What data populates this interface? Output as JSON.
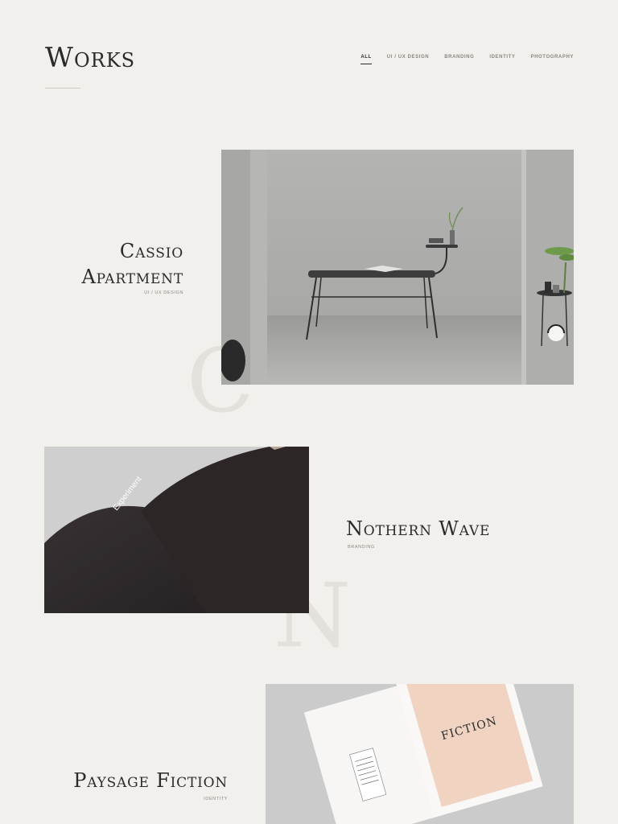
{
  "header": {
    "title": "Works",
    "filters": [
      {
        "label": "ALL",
        "active": true
      },
      {
        "label": "UI / UX DESIGN",
        "active": false
      },
      {
        "label": "BRANDING",
        "active": false
      },
      {
        "label": "IDENTITY",
        "active": false
      },
      {
        "label": "PHOTOGRAPHY",
        "active": false
      }
    ]
  },
  "projects": [
    {
      "title_line1": "Cassio",
      "title_line2": "Apartment",
      "category": "UI / UX DESIGN",
      "bg_letter": "C"
    },
    {
      "title": "Nothern Wave",
      "category": "BRANDING",
      "bg_letter": "N",
      "book_text": "Experiment"
    },
    {
      "title": "Paysage Fiction",
      "category": "IDENTITY",
      "brochure_text": "FICTION"
    }
  ],
  "colors": {
    "background": "#f2f0ed",
    "text": "#2b2b2b",
    "muted": "#8a8782"
  }
}
